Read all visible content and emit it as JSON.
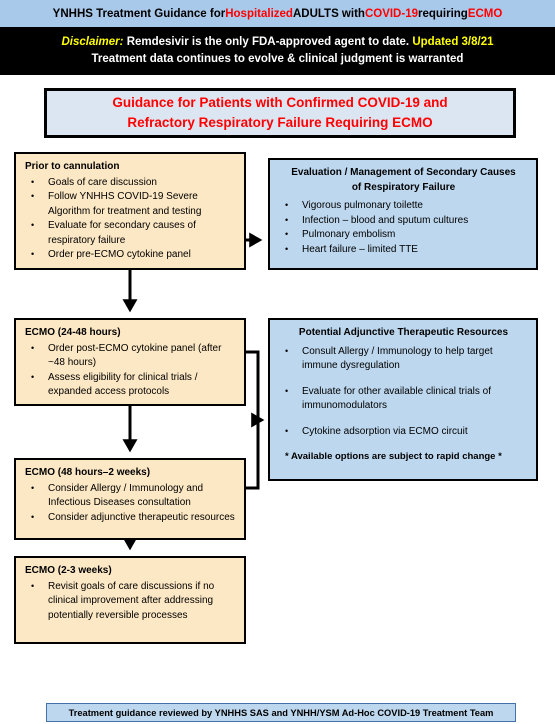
{
  "header": {
    "title_parts": [
      {
        "text": "YNHHS Treatment Guidance for ",
        "color": "black"
      },
      {
        "text": "Hospitalized",
        "color": "red"
      },
      {
        "text": " ADULTS with ",
        "color": "black"
      },
      {
        "text": "COVID-19",
        "color": "red"
      },
      {
        "text": " requiring ",
        "color": "black"
      },
      {
        "text": "ECMO",
        "color": "red"
      }
    ],
    "title_plain": "YNHHS Treatment Guidance for Hospitalized ADULTS with COVID-19 requiring ECMO",
    "bar_color": "#a9c9ea"
  },
  "disclaimer": {
    "label": "Disclaimer:",
    "line1_text": "Remdesivir is the only FDA-approved agent to date.",
    "updated": "Updated 3/8/21",
    "line2": "Treatment data continues to evolve & clinical judgment is warranted",
    "background": "#000000",
    "label_color": "#ffff00",
    "updated_color": "#ffff00"
  },
  "main_banner": {
    "line1": "Guidance for Patients with Confirmed COVID-19 and",
    "line2": "Refractory Respiratory Failure Requiring ECMO",
    "text_color": "#ff0000",
    "background": "#dce6f2"
  },
  "boxes": {
    "prior_to_cannulation": {
      "title": "Prior to cannulation",
      "items": [
        "Goals of care discussion",
        "Follow YNHHS COVID-19 Severe Algorithm for treatment and testing",
        "Evaluate for secondary causes of respiratory failure",
        "Order pre-ECMO cytokine panel"
      ],
      "fill": "#fce8c4"
    },
    "evaluation_secondary_causes": {
      "title_line1": "Evaluation / Management of  Secondary Causes",
      "title_line2": "of Respiratory Failure",
      "items": [
        "Vigorous pulmonary toilette",
        "Infection – blood and sputum cultures",
        "Pulmonary embolism",
        "Heart failure – limited TTE"
      ],
      "fill": "#bdd7ee"
    },
    "ecmo_24_48": {
      "title": "ECMO (24-48 hours)",
      "items": [
        "Order post-ECMO cytokine panel (after ~48 hours)",
        "Assess eligibility for clinical trials / expanded access protocols"
      ],
      "fill": "#fce8c4"
    },
    "adjunctive_resources": {
      "title": "Potential Adjunctive Therapeutic Resources",
      "items": [
        "Consult Allergy / Immunology to help target immune dysregulation",
        "Evaluate for other available clinical trials of immunomodulators",
        "Cytokine adsorption via ECMO circuit"
      ],
      "note": "* Available options are subject to rapid change *",
      "fill": "#bdd7ee"
    },
    "ecmo_48_2weeks": {
      "title": "ECMO (48 hours–2 weeks)",
      "items": [
        "Consider Allergy / Immunology and Infectious Diseases consultation",
        "Consider adjunctive therapeutic resources"
      ],
      "fill": "#fce8c4"
    },
    "ecmo_2_3weeks": {
      "title": "ECMO (2-3 weeks)",
      "items": [
        "Revisit goals of care discussions if no clinical improvement after addressing potentially reversible processes"
      ],
      "fill": "#fce8c4"
    }
  },
  "footer": {
    "text": "Treatment guidance  reviewed by YNHHS SAS and YNHH/YSM Ad-Hoc COVID-19 Treatment Team",
    "background": "#bdd7ee"
  }
}
